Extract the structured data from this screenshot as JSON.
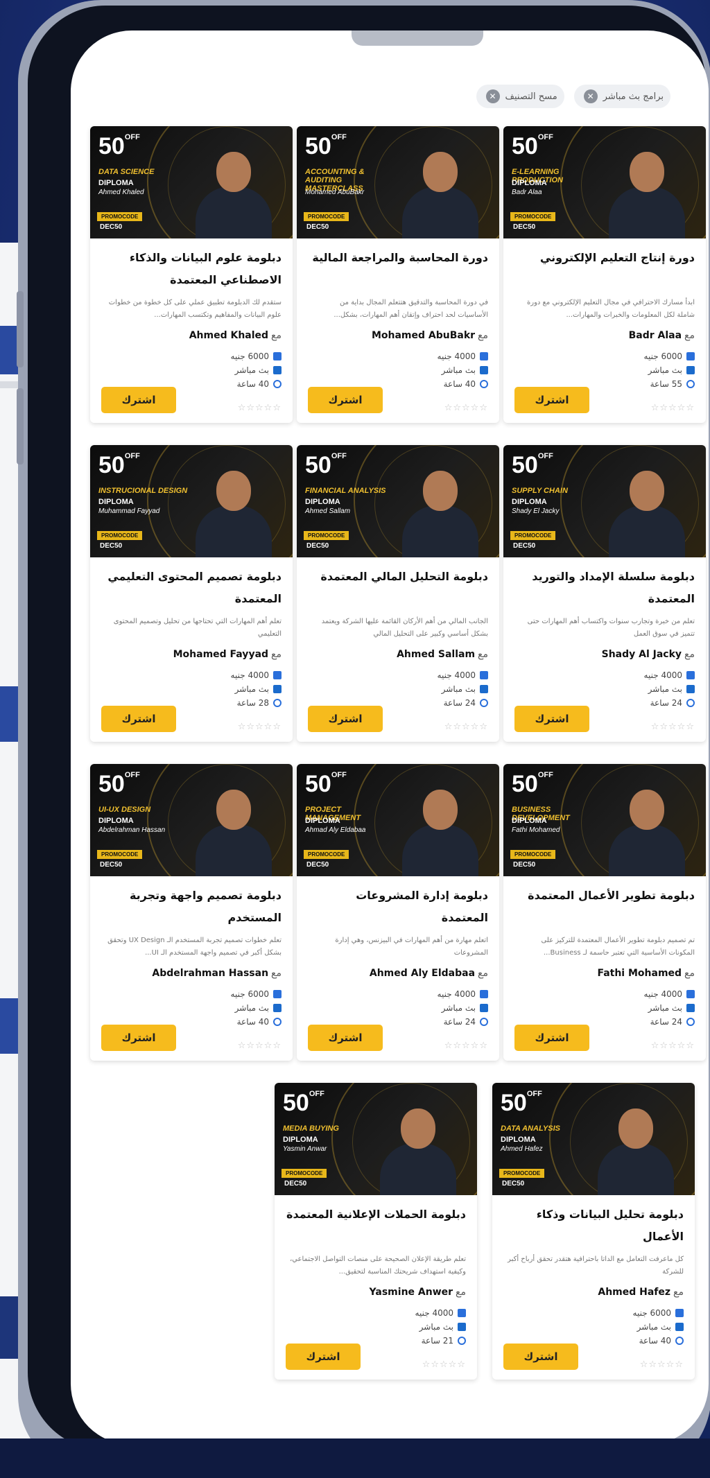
{
  "filters": [
    {
      "label": "برامج بث مباشر"
    },
    {
      "label": "مسح التصنيف"
    }
  ],
  "courses": [
    {
      "pct": "50",
      "off": "OFF",
      "btitle": "E-LEARNING PRODUCTION",
      "bdiploma": "DIPLOMA",
      "bname": "Badr Alaa",
      "title": "دورة إنتاج التعليم الإلكتروني",
      "desc": "ابدأ مسارك الاحترافي في مجال التعليم الإلكتروني مع دورة شاملة لكل المعلومات والخبرات والمهارات...",
      "with": "مع",
      "instructor": "Badr Alaa",
      "price": "6000 جنيه",
      "live": "بث مباشر",
      "hours": "55 ساعة",
      "stars": "☆☆☆☆☆",
      "cta": "اشترك"
    },
    {
      "pct": "50",
      "off": "OFF",
      "btitle": "ACCOUNTING & AUDITING MASTERCLASS",
      "bdiploma": "",
      "bname": "Mohamed AbuBakr",
      "title": "دورة المحاسبة والمراجعة المالية",
      "desc": "في دورة المحاسبة والتدقيق هتتعلم المجال بداية من الأساسيات لحد احتراف وإتقان أهم المهارات، بشكل...",
      "with": "مع",
      "instructor": "Mohamed AbuBakr",
      "price": "4000 جنيه",
      "live": "بث مباشر",
      "hours": "40 ساعة",
      "stars": "☆☆☆☆☆",
      "cta": "اشترك"
    },
    {
      "pct": "50",
      "off": "OFF",
      "btitle": "DATA SCIENCE",
      "bdiploma": "DIPLOMA",
      "bname": "Ahmed Khaled",
      "title": "دبلومة علوم البيانات والذكاء الاصطناعي المعتمدة",
      "desc": "ستقدم لك الدبلومة تطبيق عملي على كل خطوة من خطوات علوم البيانات والمفاهيم وتكتسب المهارات...",
      "with": "مع",
      "instructor": "Ahmed Khaled",
      "price": "6000 جنيه",
      "live": "بث مباشر",
      "hours": "40 ساعة",
      "stars": "☆☆☆☆☆",
      "cta": "اشترك"
    },
    {
      "pct": "50",
      "off": "OFF",
      "btitle": "SUPPLY CHAIN",
      "bdiploma": "DIPLOMA",
      "bname": "Shady El Jacky",
      "title": "دبلومة سلسلة الإمداد والتوريد المعتمدة",
      "desc": "تعلم من خبرة وتجارب سنوات واكتساب أهم المهارات حتى تتميز في سوق العمل",
      "with": "مع",
      "instructor": "Shady Al Jacky",
      "price": "4000 جنيه",
      "live": "بث مباشر",
      "hours": "24 ساعة",
      "stars": "☆☆☆☆☆",
      "cta": "اشترك"
    },
    {
      "pct": "50",
      "off": "OFF",
      "btitle": "FINANCIAL ANALYSIS",
      "bdiploma": "DIPLOMA",
      "bname": "Ahmed Sallam",
      "title": "دبلومة التحليل المالي المعتمدة",
      "desc": "الجانب المالي من أهم الأركان القائمة عليها الشركة ويعتمد بشكل أساسي وكبير على التحليل المالي",
      "with": "مع",
      "instructor": "Ahmed Sallam",
      "price": "4000 جنيه",
      "live": "بث مباشر",
      "hours": "24 ساعة",
      "stars": "☆☆☆☆☆",
      "cta": "اشترك"
    },
    {
      "pct": "50",
      "off": "OFF",
      "btitle": "INSTRUCIONAL DESIGN",
      "bdiploma": "DIPLOMA",
      "bname": "Muhammad Fayyad",
      "title": "دبلومة تصميم المحتوى التعليمي المعتمدة",
      "desc": "تعلم أهم المهارات التي تحتاجها من تحليل وتصميم المحتوى التعليمي",
      "with": "مع",
      "instructor": "Mohamed Fayyad",
      "price": "4000 جنيه",
      "live": "بث مباشر",
      "hours": "28 ساعة",
      "stars": "☆☆☆☆☆",
      "cta": "اشترك"
    },
    {
      "pct": "50",
      "off": "OFF",
      "btitle": "BUSINESS DEVELOPMENT",
      "bdiploma": "DIPLOMA",
      "bname": "Fathi Mohamed",
      "title": "دبلومة تطوير الأعمال المعتمدة",
      "desc": "تم تصميم دبلومة تطوير الأعمال المعتمدة للتركيز على المكونات الأساسية التي تعتبر حاسمة لـ Business...",
      "with": "مع",
      "instructor": "Fathi Mohamed",
      "price": "4000 جنيه",
      "live": "بث مباشر",
      "hours": "24 ساعة",
      "stars": "☆☆☆☆☆",
      "cta": "اشترك"
    },
    {
      "pct": "50",
      "off": "OFF",
      "btitle": "PROJECT MANAGEMENT",
      "bdiploma": "DIPLOMA",
      "bname": "Ahmad Aly Eldabaa",
      "title": "دبلومة إدارة المشروعات المعتمدة",
      "desc": "اتعلم مهارة من أهم المهارات في البيزنس، وهي إدارة المشروعات",
      "with": "مع",
      "instructor": "Ahmed Aly Eldabaa",
      "price": "4000 جنيه",
      "live": "بث مباشر",
      "hours": "24 ساعة",
      "stars": "☆☆☆☆☆",
      "cta": "اشترك"
    },
    {
      "pct": "50",
      "off": "OFF",
      "btitle": "UI-UX DESIGN",
      "bdiploma": "DIPLOMA",
      "bname": "Abdelrahman Hassan",
      "title": "دبلومة تصميم واجهة وتجربة المستخدم",
      "desc": "تعلم خطوات تصميم تجربة المستخدم الـ UX Design وتحقق بشكل أكبر في تصميم واجهة المستخدم الـ UI...",
      "with": "مع",
      "instructor": "Abdelrahman Hassan",
      "price": "6000 جنيه",
      "live": "بث مباشر",
      "hours": "40 ساعة",
      "stars": "☆☆☆☆☆",
      "cta": "اشترك"
    },
    {
      "pct": "50",
      "off": "OFF",
      "btitle": "DATA ANALYSIS",
      "bdiploma": "DIPLOMA",
      "bname": "Ahmed Hafez",
      "title": "دبلومة تحليل البيانات وذكاء الأعمال",
      "desc": "كل ماعرفت التعامل مع الداتا باحترافية هتقدر تحقق أرباح أكبر للشركة",
      "with": "مع",
      "instructor": "Ahmed Hafez",
      "price": "6000 جنيه",
      "live": "بث مباشر",
      "hours": "40 ساعة",
      "stars": "☆☆☆☆☆",
      "cta": "اشترك"
    },
    {
      "pct": "50",
      "off": "OFF",
      "btitle": "MEDIA BUYING",
      "bdiploma": "DIPLOMA",
      "bname": "Yasmin Anwar",
      "title": "دبلومة الحملات الإعلانية المعتمدة",
      "desc": "تعلم طريقة الإعلان الصحيحة على منصات التواصل الاجتماعي، وكيفية استهداف شريحتك المناسبة لتحقيق...",
      "with": "مع",
      "instructor": "Yasmine Anwer",
      "price": "4000 جنيه",
      "live": "بث مباشر",
      "hours": "21 ساعة",
      "stars": "☆☆☆☆☆",
      "cta": "اشترك"
    }
  ],
  "colors": {
    "accent": "#f6bb1d",
    "brand": "#1f3b8c",
    "icon": "#2a6fdb"
  }
}
